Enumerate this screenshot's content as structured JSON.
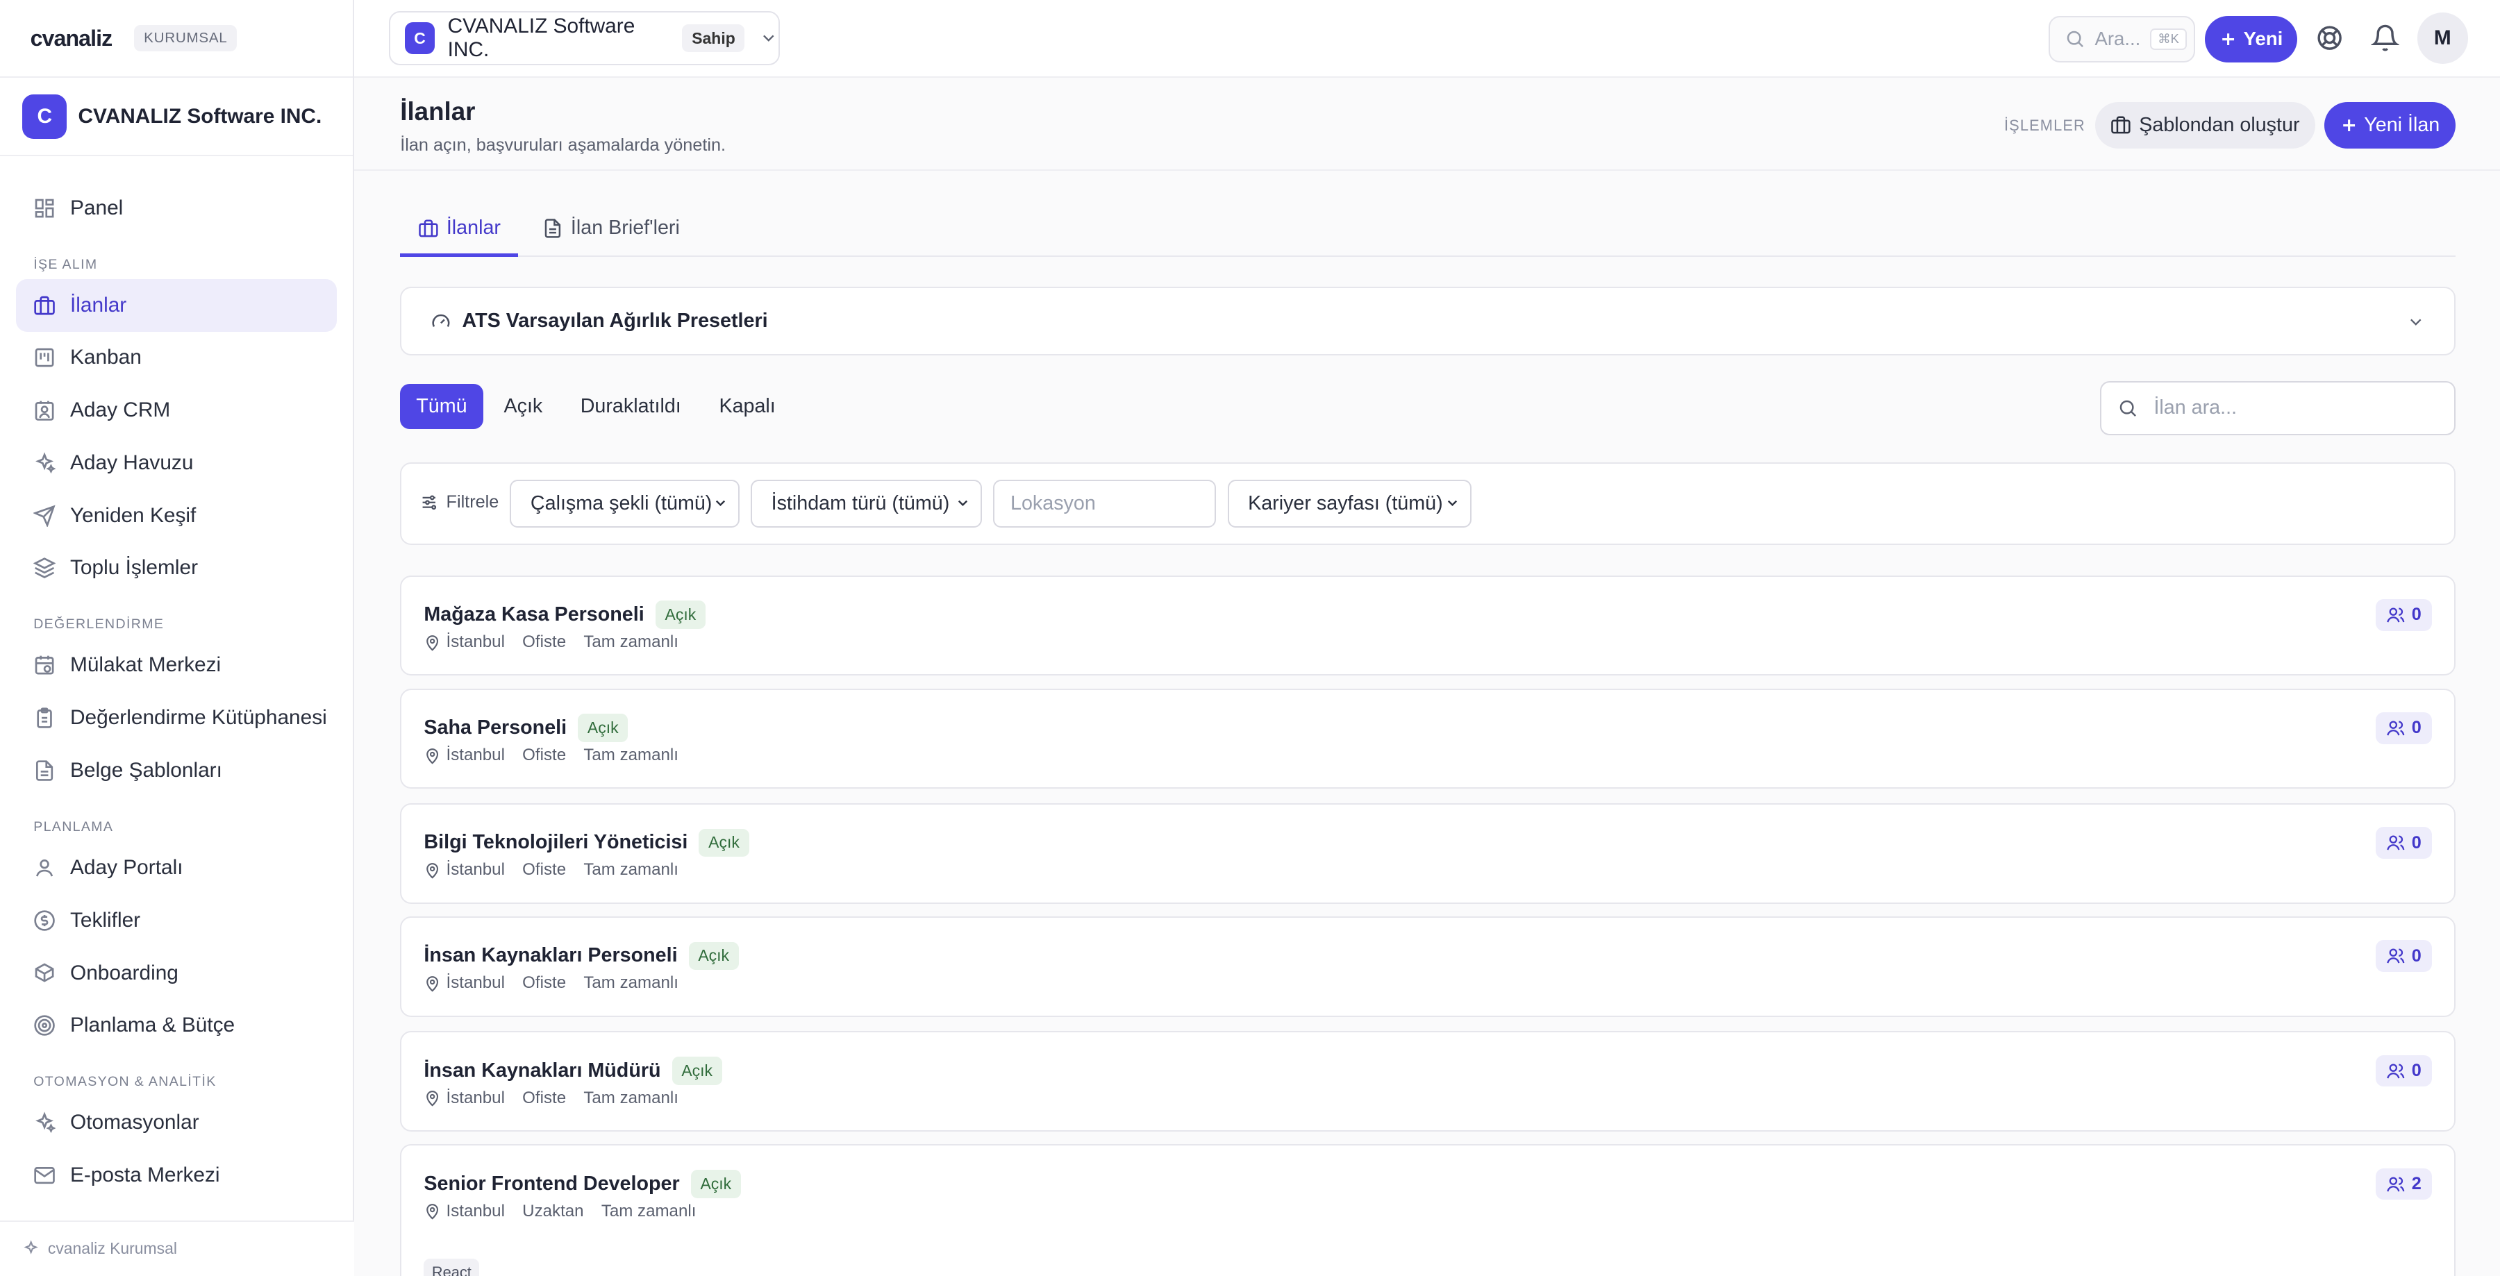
{
  "brand": {
    "logo": "cvanaliz",
    "plan": "KURUMSAL"
  },
  "org": {
    "initial": "C",
    "name": "CVANALIZ Software INC.",
    "role": "Sahip"
  },
  "sidebar": {
    "panel": "Panel",
    "sections": [
      {
        "title": "İŞE ALIM",
        "items": [
          "İlanlar",
          "Kanban",
          "Aday CRM",
          "Aday Havuzu",
          "Yeniden Keşif",
          "Toplu İşlemler"
        ]
      },
      {
        "title": "DEĞERLENDİRME",
        "items": [
          "Mülakat Merkezi",
          "Değerlendirme Kütüphanesi",
          "Belge Şablonları"
        ]
      },
      {
        "title": "PLANLAMA",
        "items": [
          "Aday Portalı",
          "Teklifler",
          "Onboarding",
          "Planlama & Bütçe"
        ]
      },
      {
        "title": "OTOMASYON & ANALİTİK",
        "items": [
          "Otomasyonlar",
          "E-posta Merkezi"
        ]
      }
    ],
    "footer": "cvanaliz Kurumsal"
  },
  "topbar": {
    "search_placeholder": "Ara...",
    "kbd": "⌘K",
    "new_label": "Yeni",
    "user_initial": "M"
  },
  "page": {
    "title": "İlanlar",
    "subtitle": "İlan açın, başvuruları aşamalarda yönetin.",
    "actions_label": "İŞLEMLER",
    "template_button": "Şablondan oluştur",
    "new_button": "Yeni İlan"
  },
  "tabs": [
    "İlanlar",
    "İlan Brief'leri"
  ],
  "preset": {
    "title": "ATS Varsayılan Ağırlık Presetleri"
  },
  "status_filters": [
    "Tümü",
    "Açık",
    "Duraklatıldı",
    "Kapalı"
  ],
  "job_search_placeholder": "İlan ara...",
  "filters": {
    "label": "Filtrele",
    "work_mode": "Çalışma şekli (tümü)",
    "employment": "İstihdam türü (tümü)",
    "location_placeholder": "Lokasyon",
    "career_page": "Kariyer sayfası (tümü)"
  },
  "jobs": [
    {
      "title": "Mağaza Kasa Personeli",
      "status": "Açık",
      "location": "İstanbul",
      "mode": "Ofiste",
      "type": "Tam zamanlı",
      "count": "0"
    },
    {
      "title": "Saha Personeli",
      "status": "Açık",
      "location": "İstanbul",
      "mode": "Ofiste",
      "type": "Tam zamanlı",
      "count": "0"
    },
    {
      "title": "Bilgi Teknolojileri Yöneticisi",
      "status": "Açık",
      "location": "İstanbul",
      "mode": "Ofiste",
      "type": "Tam zamanlı",
      "count": "0"
    },
    {
      "title": "İnsan Kaynakları Personeli",
      "status": "Açık",
      "location": "İstanbul",
      "mode": "Ofiste",
      "type": "Tam zamanlı",
      "count": "0"
    },
    {
      "title": "İnsan Kaynakları Müdürü",
      "status": "Açık",
      "location": "İstanbul",
      "mode": "Ofiste",
      "type": "Tam zamanlı",
      "count": "0"
    },
    {
      "title": "Senior Frontend Developer",
      "status": "Açık",
      "location": "Istanbul",
      "mode": "Uzaktan",
      "type": "Tam zamanlı",
      "count": "2",
      "tag": "React"
    }
  ],
  "colors": {
    "accent": "#4f46e5",
    "accent_soft": "#eeedfb",
    "status_open_bg": "#e8f3e9",
    "status_open_text": "#2f6b3a"
  }
}
